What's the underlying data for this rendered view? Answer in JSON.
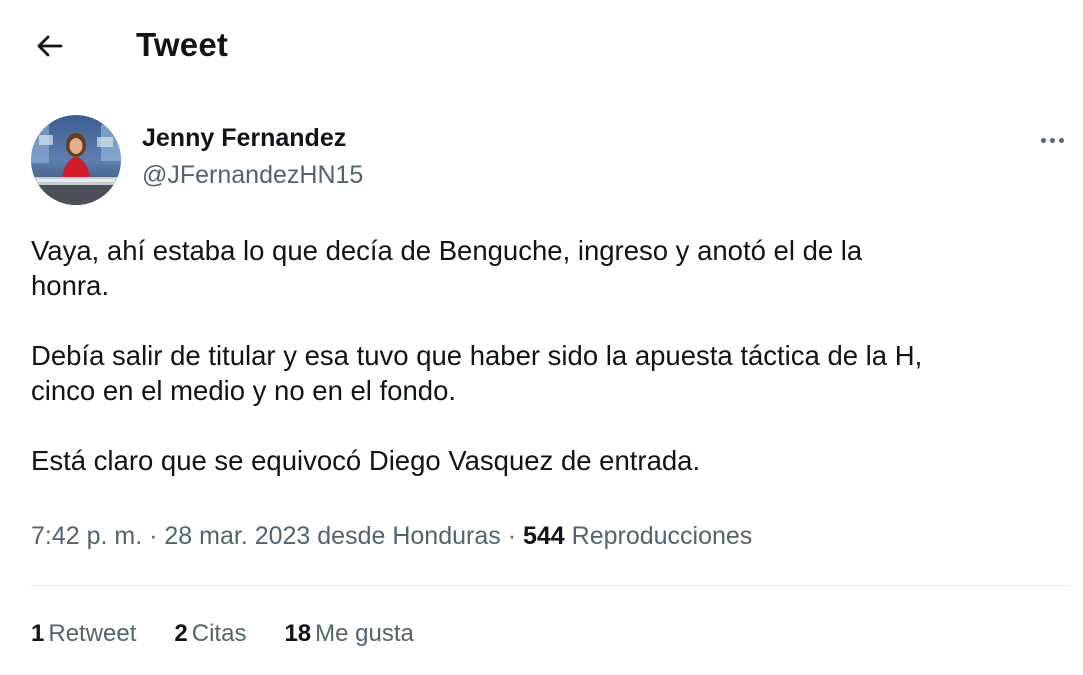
{
  "header": {
    "title": "Tweet",
    "back_icon": "arrow-left-icon"
  },
  "author": {
    "name": "Jenny Fernandez",
    "handle": "@JFernandezHN15",
    "more_icon": "more-horizontal-icon"
  },
  "tweet": {
    "paragraphs": [
      "Vaya, ahí estaba lo que decía de Benguche, ingreso y anotó el de la honra.",
      "Debía salir de titular y esa tuvo que haber sido la apuesta táctica de la H, cinco en el medio y no en el fondo.",
      "Está claro que se equivocó Diego Vasquez de entrada."
    ],
    "lines": {
      "p1_l1": "Vaya, ahí estaba lo que decía de Benguche, ingreso y anotó el de la",
      "p1_l2": "honra.",
      "p2_l1": "Debía salir de titular y esa tuvo que haber sido la apuesta táctica de la H,",
      "p2_l2": "cinco en el medio y no en el fondo.",
      "p3_l1": "Está claro que se equivocó Diego Vasquez de entrada."
    }
  },
  "meta": {
    "time": "7:42 p. m.",
    "sep1": " · ",
    "date": "28 mar. 2023",
    "location_prefix": " desde ",
    "location": "Honduras",
    "sep2": " · ",
    "views_count": "544",
    "views_label": "Reproducciones"
  },
  "stats": {
    "retweets_count": "1",
    "retweets_label": "Retweet",
    "quotes_count": "2",
    "quotes_label": "Citas",
    "likes_count": "18",
    "likes_label": "Me gusta"
  },
  "colors": {
    "text_primary": "#0f1419",
    "text_secondary": "#536471",
    "divider": "#e6ecf0",
    "background": "#ffffff"
  }
}
